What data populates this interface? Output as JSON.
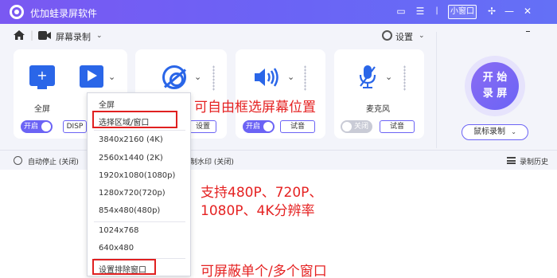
{
  "app": {
    "title": "优加蛙录屏软件",
    "mini_window": "小窗口"
  },
  "toolbar": {
    "mode": "屏幕录制",
    "settings": "设置"
  },
  "panels": {
    "screen": {
      "label": "全屏",
      "toggle": "开启",
      "disp_btn": "DISP"
    },
    "camera": {
      "settings_btn": "设置"
    },
    "audio": {
      "toggle": "开启",
      "test_btn": "试音"
    },
    "mic": {
      "label": "麦克风",
      "toggle": "关闭",
      "test_btn": "试音"
    },
    "record": {
      "line1": "开 始",
      "line2": "录 屏",
      "hotkey": "鼠标录制"
    }
  },
  "statusbar": {
    "auto_stop": "自动停止 (关闭)",
    "watermark": "录制水印 (关闭)",
    "history": "录制历史"
  },
  "dropdown": {
    "items": [
      "全屏",
      "选择区域/窗口",
      "3840x2160 (4K)",
      "2560x1440 (2K)",
      "1920x1080(1080p)",
      "1280x720(720p)",
      "854x480(480p)",
      "1024x768",
      "640x480",
      "设置排除窗口"
    ]
  },
  "annotations": {
    "a1": "可自由框选屏幕位置",
    "a2": "支持480P、720P、",
    "a3": "1080P、4K分辨率",
    "a4": "可屏蔽单个/多个窗口"
  },
  "colors": {
    "accent": "#6b63f5",
    "icon_blue": "#2a66e8",
    "annotation_red": "#e52222"
  }
}
